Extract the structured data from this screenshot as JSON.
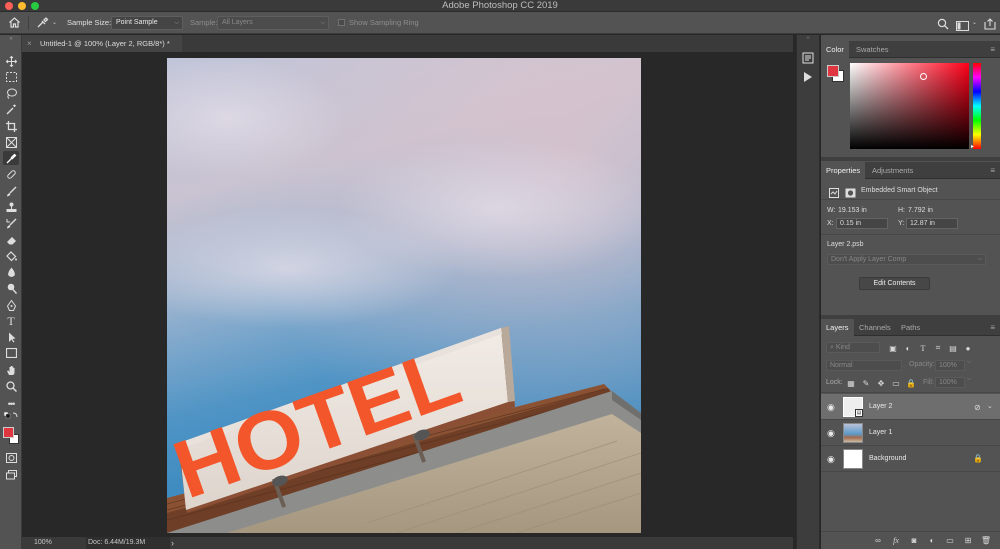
{
  "window": {
    "title": "Adobe Photoshop CC 2019"
  },
  "options_bar": {
    "sample_size_label": "Sample Size:",
    "sample_size_value": "Point Sample",
    "sample_label": "Sample:",
    "sample_value": "All Layers",
    "show_ring_label": "Show Sampling Ring"
  },
  "document_tab": {
    "title": "Untitled-1 @ 100% (Layer 2, RGB/8*) *",
    "close": "×"
  },
  "canvas": {
    "sign_text": "HOTEL"
  },
  "status_bar": {
    "zoom": "100%",
    "doc_info": "Doc: 6.44M/19.3M",
    "arrow": "›"
  },
  "color_panel": {
    "tabs": [
      "Color",
      "Swatches"
    ],
    "foreground_color": "#E0363F",
    "background_color": "#FFFFFF",
    "hue_color": "#FF0019"
  },
  "properties_panel": {
    "tabs": [
      "Properties",
      "Adjustments"
    ],
    "kind": "Embedded Smart Object",
    "w_label": "W:",
    "w_value": "19.153 in",
    "h_label": "H:",
    "h_value": "7.792 in",
    "x_label": "X:",
    "x_value": "0.15 in",
    "y_label": "Y:",
    "y_value": "12.87 in",
    "source_file": "Layer 2.psb",
    "layer_comp": "Don't Apply Layer Comp",
    "edit_button": "Edit Contents"
  },
  "layers_panel": {
    "tabs": [
      "Layers",
      "Channels",
      "Paths"
    ],
    "filter": "Kind",
    "blend_mode": "Normal",
    "opacity_label": "Opacity:",
    "opacity_value": "100%",
    "lock_label": "Lock:",
    "fill_label": "Fill:",
    "fill_value": "100%",
    "layers": [
      {
        "name": "Layer 2",
        "selected": true
      },
      {
        "name": "Layer 1",
        "selected": false
      },
      {
        "name": "Background",
        "selected": false
      }
    ]
  },
  "colors": {
    "accent_orange": "#F2562A",
    "ui_dark": "#535353"
  }
}
